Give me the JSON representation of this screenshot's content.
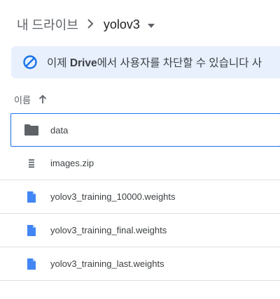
{
  "breadcrumb": {
    "root": "내 드라이브",
    "separator": ">",
    "current": "yolov3"
  },
  "banner": {
    "text_before": "이제 ",
    "text_bold": "Drive",
    "text_after": "에서 사용자를 차단할 수 있습니다 사"
  },
  "sort": {
    "label": "이름"
  },
  "files": [
    {
      "name": "data",
      "type": "folder"
    },
    {
      "name": "images.zip",
      "type": "zip"
    },
    {
      "name": "yolov3_training_10000.weights",
      "type": "file"
    },
    {
      "name": "yolov3_training_final.weights",
      "type": "file"
    },
    {
      "name": "yolov3_training_last.weights",
      "type": "file"
    }
  ],
  "colors": {
    "accent": "#1a73e8",
    "banner_bg": "#e8f0fe",
    "folder_icon": "#5f6368",
    "file_icon": "#4285f4"
  }
}
